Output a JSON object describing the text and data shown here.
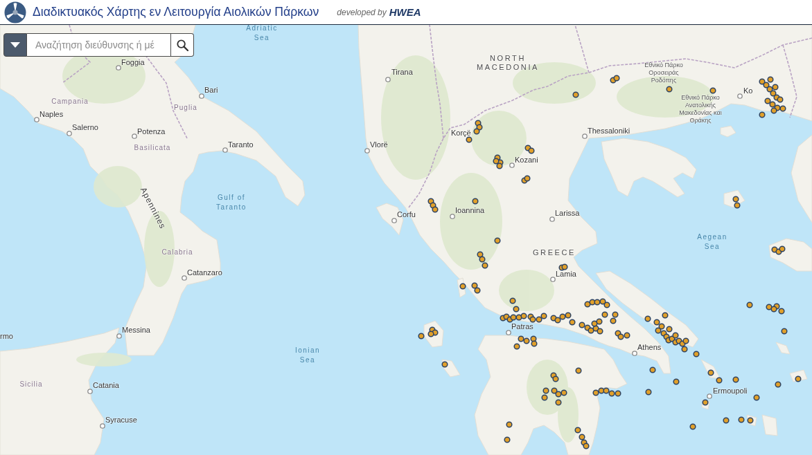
{
  "header": {
    "title": "Διαδικτυακός Χάρτης εν Λειτουργία Αιολικών Πάρκων",
    "credit": "developed by",
    "brand": "HWEA"
  },
  "search": {
    "placeholder": "Αναζήτηση διεύθυνσης ή μέ"
  },
  "map": {
    "labels": [
      {
        "text": "Adriatic\nSea",
        "kind": "water"
      },
      {
        "text": "Foggia",
        "kind": "city"
      },
      {
        "text": "Bari",
        "kind": "city"
      },
      {
        "text": "Campania",
        "kind": "region"
      },
      {
        "text": "Naples",
        "kind": "city"
      },
      {
        "text": "Puglia",
        "kind": "region"
      },
      {
        "text": "Salerno",
        "kind": "city"
      },
      {
        "text": "Potenza",
        "kind": "city"
      },
      {
        "text": "Basilicata",
        "kind": "region"
      },
      {
        "text": "Taranto",
        "kind": "city"
      },
      {
        "text": "Gulf of\nTaranto",
        "kind": "water"
      },
      {
        "text": "Apennines",
        "kind": "mountain"
      },
      {
        "text": "Calabria",
        "kind": "region"
      },
      {
        "text": "Catanzaro",
        "kind": "city"
      },
      {
        "text": "Messina",
        "kind": "city"
      },
      {
        "text": "rmo",
        "kind": "city"
      },
      {
        "text": "Sicilia",
        "kind": "region"
      },
      {
        "text": "Catania",
        "kind": "city"
      },
      {
        "text": "Syracuse",
        "kind": "city"
      },
      {
        "text": "Ionian\nSea",
        "kind": "water"
      },
      {
        "text": "Tirana",
        "kind": "city"
      },
      {
        "text": "NORTH\nMACEDONIA",
        "kind": "country"
      },
      {
        "text": "Εθνικό Πάρκο\nΟροσειράς\nΡοδόπης",
        "kind": "park"
      },
      {
        "text": "Εθνικό Πάρκο\nΑνατολικής\nΜακεδονίας και\nΘράκης",
        "kind": "park"
      },
      {
        "text": "Korçë",
        "kind": "city"
      },
      {
        "text": "Ko",
        "kind": "city"
      },
      {
        "text": "Thessaloniki",
        "kind": "city"
      },
      {
        "text": "Vlorë",
        "kind": "city"
      },
      {
        "text": "Kozani",
        "kind": "city"
      },
      {
        "text": "Corfu",
        "kind": "city"
      },
      {
        "text": "Ioannina",
        "kind": "city"
      },
      {
        "text": "Larissa",
        "kind": "city"
      },
      {
        "text": "GREECE",
        "kind": "country"
      },
      {
        "text": "Aegean\nSea",
        "kind": "water"
      },
      {
        "text": "Lamia",
        "kind": "city"
      },
      {
        "text": "Patras",
        "kind": "city"
      },
      {
        "text": "Athens",
        "kind": "city"
      },
      {
        "text": "Ermoupoli",
        "kind": "city"
      }
    ]
  }
}
